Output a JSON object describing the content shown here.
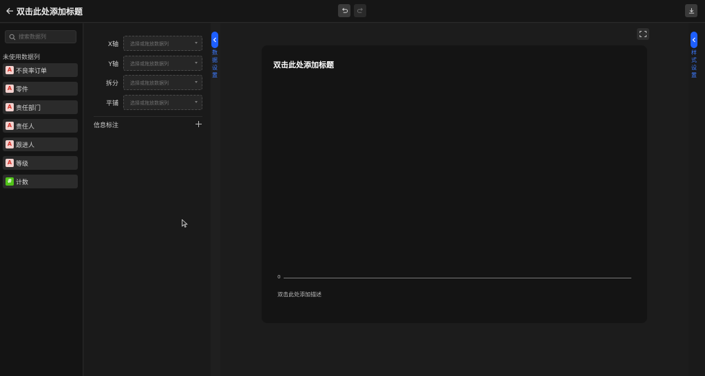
{
  "header": {
    "title": "双击此处添加标题",
    "back_icon": "arrow-left-icon",
    "undo_icon": "undo-icon",
    "redo_icon": "redo-icon",
    "download_icon": "download-icon"
  },
  "sidebar": {
    "search_placeholder": "搜索数据列",
    "section_label": "未使用数据列",
    "items": [
      {
        "label": "不良率订单",
        "type": "A"
      },
      {
        "label": "零件",
        "type": "A"
      },
      {
        "label": "责任部门",
        "type": "A"
      },
      {
        "label": "责任人",
        "type": "A"
      },
      {
        "label": "跟进人",
        "type": "A"
      },
      {
        "label": "等级",
        "type": "A"
      },
      {
        "label": "计数",
        "type": "#"
      }
    ]
  },
  "config": {
    "rows": [
      {
        "label": "X轴",
        "placeholder": "选择或拖放数据列"
      },
      {
        "label": "Y轴",
        "placeholder": "选择或拖放数据列"
      },
      {
        "label": "拆分",
        "placeholder": "选择或拖放数据列"
      },
      {
        "label": "平铺",
        "placeholder": "选择或拖放数据列"
      }
    ],
    "info_label": "信息标注",
    "data_settings_tab": "数据设置",
    "style_settings_tab": "样式设置"
  },
  "chart_card": {
    "title": "双击此处添加标题",
    "axis_zero": "0",
    "description": "双击此处添加描述"
  },
  "colors": {
    "accent": "#1e5fff",
    "text_badge_bg": "#f3d2cf",
    "text_badge_fg": "#d9352c",
    "num_badge_bg": "#52c41a"
  }
}
